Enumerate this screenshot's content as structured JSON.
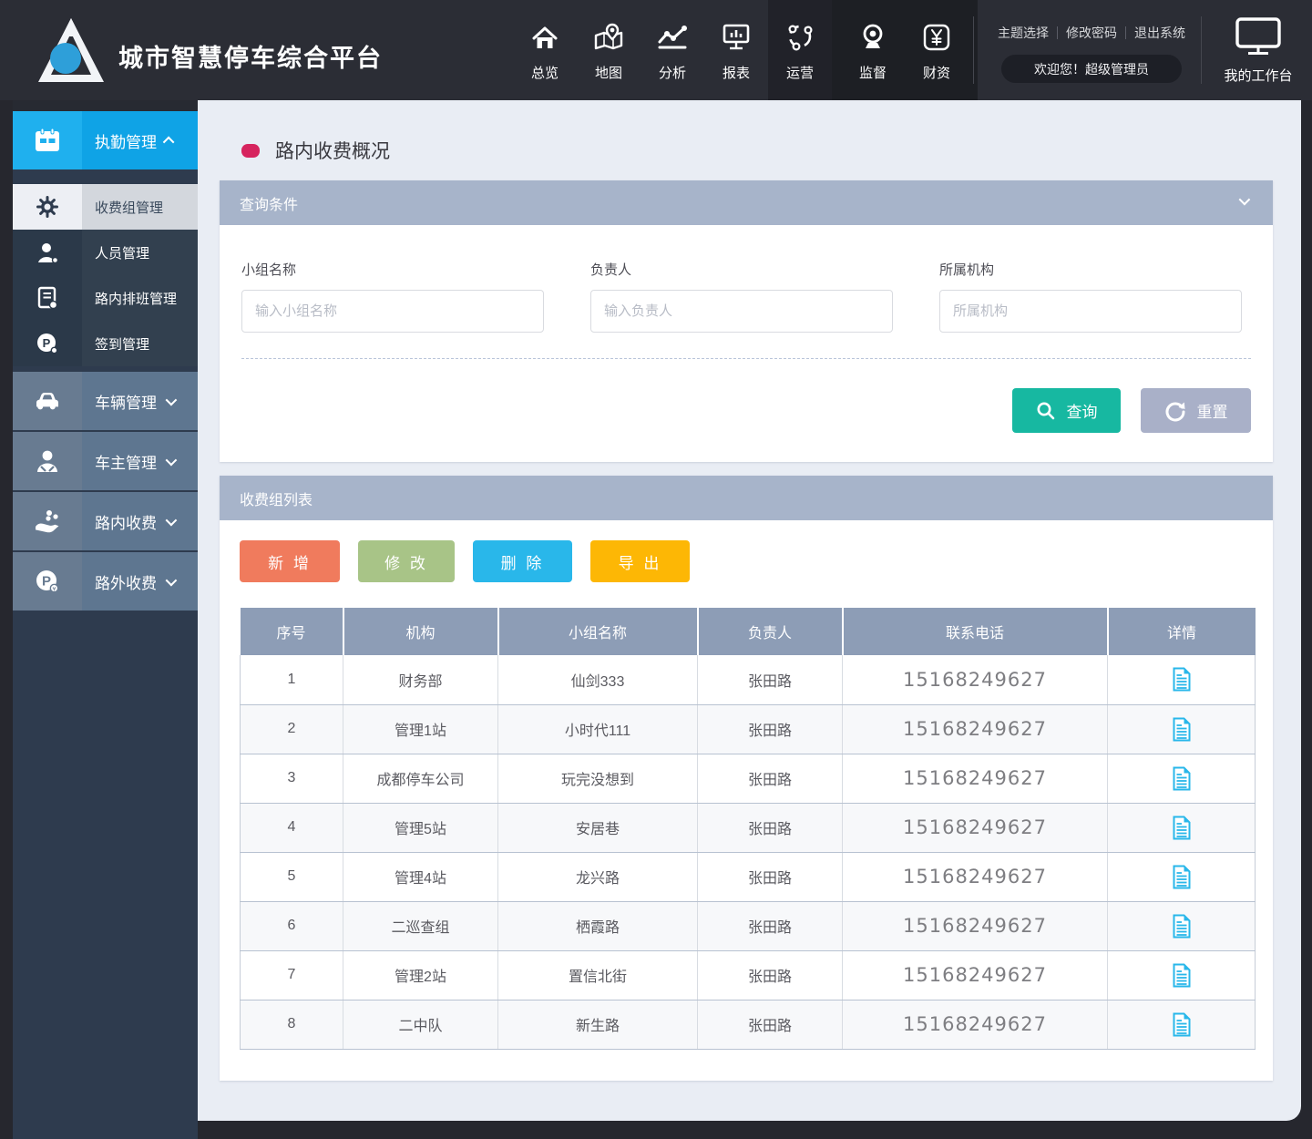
{
  "app": {
    "title": "城市智慧停车综合平台"
  },
  "header": {
    "nav": [
      {
        "label": "总览",
        "icon": "home-icon",
        "active": false
      },
      {
        "label": "地图",
        "icon": "map-icon",
        "active": false
      },
      {
        "label": "分析",
        "icon": "analytics-icon",
        "active": false
      },
      {
        "label": "报表",
        "icon": "report-icon",
        "active": false
      },
      {
        "label": "运营",
        "icon": "operations-icon",
        "active": true
      },
      {
        "label": "监督",
        "icon": "monitor-camera-icon",
        "active": false
      },
      {
        "label": "财资",
        "icon": "finance-yuan-icon",
        "active": false
      }
    ],
    "links": [
      "主题选择",
      "修改密码",
      "退出系统"
    ],
    "welcome": "欢迎您！超级管理员",
    "workbench": "我的工作台"
  },
  "sidebar": {
    "root": {
      "label": "执勤管理",
      "icon": "calendar-icon",
      "expanded": true
    },
    "sub": [
      {
        "label": "收费组管理",
        "icon": "gear-icon",
        "selected": true
      },
      {
        "label": "人员管理",
        "icon": "person-icon",
        "selected": false
      },
      {
        "label": "路内排班管理",
        "icon": "schedule-icon",
        "selected": false
      },
      {
        "label": "签到管理",
        "icon": "sign-in-icon",
        "selected": false
      }
    ],
    "groups": [
      {
        "label": "车辆管理",
        "icon": "car-icon"
      },
      {
        "label": "车主管理",
        "icon": "driver-icon"
      },
      {
        "label": "路内收费",
        "icon": "coins-hand-icon"
      },
      {
        "label": "路外收费",
        "icon": "parking-fee-icon"
      }
    ]
  },
  "page": {
    "title": "路内收费概况"
  },
  "query": {
    "header": "查询条件",
    "fields": [
      {
        "label": "小组名称",
        "placeholder": "输入小组名称",
        "value": ""
      },
      {
        "label": "负责人",
        "placeholder": "输入负责人",
        "value": ""
      },
      {
        "label": "所属机构",
        "placeholder": "所属机构",
        "value": ""
      }
    ],
    "search_label": "查询",
    "reset_label": "重置"
  },
  "list": {
    "header": "收费组列表",
    "actions": {
      "add": "新 增",
      "edit": "修 改",
      "delete": "删 除",
      "export": "导 出"
    },
    "table": {
      "columns": [
        "序号",
        "机构",
        "小组名称",
        "负责人",
        "联系电话",
        "详情"
      ],
      "rows": [
        {
          "no": "1",
          "org": "财务部",
          "group": "仙剑333",
          "owner": "张田路",
          "phone": "15168249627"
        },
        {
          "no": "2",
          "org": "管理1站",
          "group": "小时代111",
          "owner": "张田路",
          "phone": "15168249627"
        },
        {
          "no": "3",
          "org": "成都停车公司",
          "group": "玩完没想到",
          "owner": "张田路",
          "phone": "15168249627"
        },
        {
          "no": "4",
          "org": "管理5站",
          "group": "安居巷",
          "owner": "张田路",
          "phone": "15168249627"
        },
        {
          "no": "5",
          "org": "管理4站",
          "group": "龙兴路",
          "owner": "张田路",
          "phone": "15168249627"
        },
        {
          "no": "6",
          "org": "二巡查组",
          "group": "栖霞路",
          "owner": "张田路",
          "phone": "15168249627"
        },
        {
          "no": "7",
          "org": "管理2站",
          "group": "置信北街",
          "owner": "张田路",
          "phone": "15168249627"
        },
        {
          "no": "8",
          "org": "二中队",
          "group": "新生路",
          "owner": "张田路",
          "phone": "15168249627"
        }
      ]
    }
  },
  "colors": {
    "accent_blue": "#0fa3e6",
    "sidebar_navy": "#2e3b4e",
    "panel_header": "#a7b4ca",
    "table_header": "#8d9db6",
    "teal_search": "#17b8a1",
    "gray_reset": "#a9b0c8",
    "salmon_add": "#f07b5d",
    "green_edit": "#a8c487",
    "blue_delete": "#29b7ea",
    "amber_export": "#fdb705",
    "crimson_bullet": "#d6245e",
    "detail_icon_cyan": "#29b7ea"
  }
}
